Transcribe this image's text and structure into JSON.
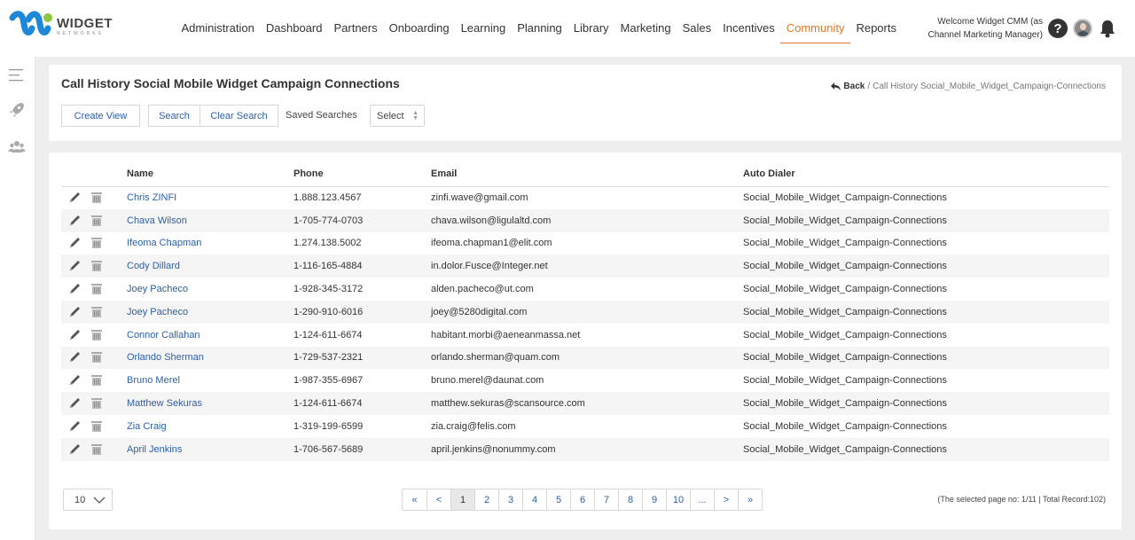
{
  "brand": {
    "name": "WIDGET",
    "tagline": "NETWORKS"
  },
  "nav": [
    {
      "label": "Administration",
      "active": false
    },
    {
      "label": "Dashboard",
      "active": false
    },
    {
      "label": "Partners",
      "active": false
    },
    {
      "label": "Onboarding",
      "active": false
    },
    {
      "label": "Learning",
      "active": false
    },
    {
      "label": "Planning",
      "active": false
    },
    {
      "label": "Library",
      "active": false
    },
    {
      "label": "Marketing",
      "active": false
    },
    {
      "label": "Sales",
      "active": false
    },
    {
      "label": "Incentives",
      "active": false
    },
    {
      "label": "Community",
      "active": true
    },
    {
      "label": "Reports",
      "active": false
    }
  ],
  "user": {
    "welcome_line1": "Welcome Widget CMM (as",
    "welcome_line2": "Channel Marketing Manager)"
  },
  "header": {
    "title": "Call History Social Mobile Widget Campaign Connections",
    "back_label": "Back",
    "breadcrumb_current": "Call History Social_Mobile_Widget_Campaign-Connections"
  },
  "toolbar": {
    "create_view": "Create View",
    "search": "Search",
    "clear_search": "Clear Search",
    "saved_searches": "Saved Searches",
    "select_value": "Select"
  },
  "table": {
    "columns": [
      "Name",
      "Phone",
      "Email",
      "Auto Dialer"
    ],
    "rows": [
      {
        "name": "Chris ZINFI",
        "phone": "1.888.123.4567",
        "email": "zinfi.wave@gmail.com",
        "dialer": "Social_Mobile_Widget_Campaign-Connections"
      },
      {
        "name": "Chava Wilson",
        "phone": "1-705-774-0703",
        "email": "chava.wilson@ligulaltd.com",
        "dialer": "Social_Mobile_Widget_Campaign-Connections"
      },
      {
        "name": "Ifeoma Chapman",
        "phone": "1.274.138.5002",
        "email": "ifeoma.chapman1@elit.com",
        "dialer": "Social_Mobile_Widget_Campaign-Connections"
      },
      {
        "name": "Cody Dillard",
        "phone": "1-116-165-4884",
        "email": "in.dolor.Fusce@Integer.net",
        "dialer": "Social_Mobile_Widget_Campaign-Connections"
      },
      {
        "name": "Joey Pacheco",
        "phone": "1-928-345-3172",
        "email": "alden.pacheco@ut.com",
        "dialer": "Social_Mobile_Widget_Campaign-Connections"
      },
      {
        "name": "Joey Pacheco",
        "phone": "1-290-910-6016",
        "email": "joey@5280digital.com",
        "dialer": "Social_Mobile_Widget_Campaign-Connections"
      },
      {
        "name": "Connor Callahan",
        "phone": "1-124-611-6674",
        "email": "habitant.morbi@aeneanmassa.net",
        "dialer": "Social_Mobile_Widget_Campaign-Connections"
      },
      {
        "name": "Orlando Sherman",
        "phone": "1-729-537-2321",
        "email": "orlando.sherman@quam.com",
        "dialer": "Social_Mobile_Widget_Campaign-Connections"
      },
      {
        "name": "Bruno Merel",
        "phone": "1-987-355-6967",
        "email": "bruno.merel@daunat.com",
        "dialer": "Social_Mobile_Widget_Campaign-Connections"
      },
      {
        "name": "Matthew Sekuras",
        "phone": "1-124-611-6674",
        "email": "matthew.sekuras@scansource.com",
        "dialer": "Social_Mobile_Widget_Campaign-Connections"
      },
      {
        "name": "Zia Craig",
        "phone": "1-319-199-6599",
        "email": "zia.craig@felis.com",
        "dialer": "Social_Mobile_Widget_Campaign-Connections"
      },
      {
        "name": "April Jenkins",
        "phone": "1-706-567-5689",
        "email": "april.jenkins@nonummy.com",
        "dialer": "Social_Mobile_Widget_Campaign-Connections"
      }
    ]
  },
  "pagination": {
    "per_page": "10",
    "first": "«",
    "prev": "<",
    "pages": [
      "1",
      "2",
      "3",
      "4",
      "5",
      "6",
      "7",
      "8",
      "9",
      "10",
      "..."
    ],
    "current": "1",
    "next": ">",
    "last": "»",
    "info": "(The selected page no: 1/11 | Total Record:102)"
  },
  "colors": {
    "accent": "#e0772a",
    "link": "#2c5fa8",
    "logo_blue": "#1e88d8",
    "logo_green": "#8cc63f"
  },
  "icons": {
    "edit": "pencil-icon",
    "delete": "trash-icon",
    "help": "help-icon",
    "notifications": "bell-icon",
    "sidebar": [
      "menu-icon",
      "rocket-icon",
      "community-icon"
    ]
  }
}
